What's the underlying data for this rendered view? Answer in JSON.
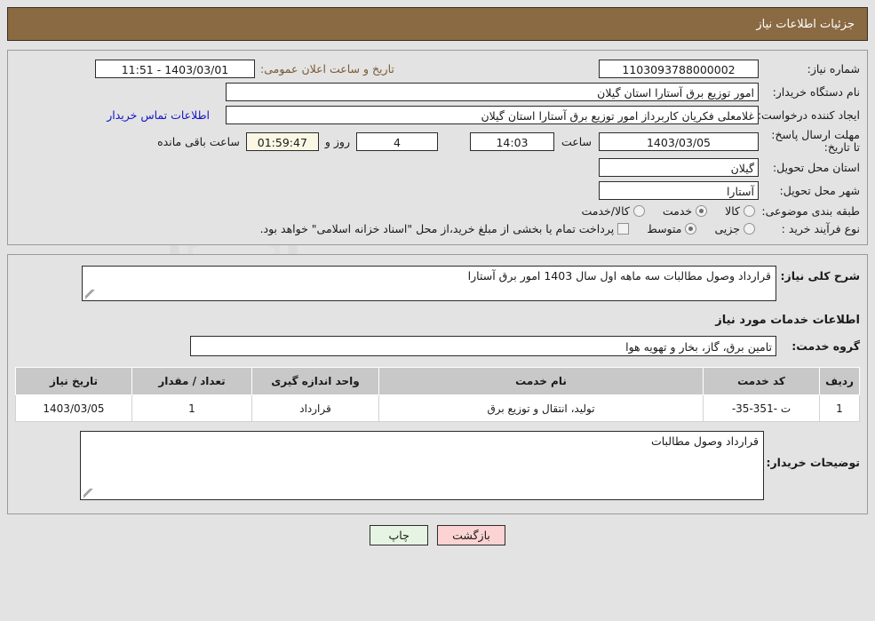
{
  "header": {
    "title": "جزئیات اطلاعات نیاز",
    "bg_color": "#8a6a42"
  },
  "watermark": {
    "text": "AnaTender.net"
  },
  "top_panel": {
    "need_number": {
      "label": "شماره نیاز:",
      "value": "1103093788000002"
    },
    "public_announce": {
      "label": "تاریخ و ساعت اعلان عمومی:",
      "value": "1403/03/01 - 11:51",
      "label_color": "#7a5a35"
    },
    "buyer_org": {
      "label": "نام دستگاه خریدار:",
      "value": "امور توزیع برق آستارا استان گیلان"
    },
    "request_creator": {
      "label": "ایجاد کننده درخواست:",
      "value": "غلامعلی فکریان کاربرداز امور توزیع برق آستارا استان گیلان"
    },
    "contact_link": {
      "label": "اطلاعات تماس خریدار",
      "color": "#1414c8"
    },
    "deadline": {
      "label": "مهلت ارسال پاسخ: تا تاریخ:",
      "date": "1403/03/05",
      "time_label": "ساعت",
      "time": "14:03",
      "days": "4",
      "days_suffix": "روز و",
      "countdown": "01:59:47",
      "countdown_suffix": "ساعت باقی مانده"
    },
    "delivery_province": {
      "label": "استان محل تحویل:",
      "value": "گیلان"
    },
    "delivery_city": {
      "label": "شهر محل تحویل:",
      "value": "آستارا"
    },
    "category": {
      "label": "طبقه بندی موضوعی:",
      "options": [
        {
          "label": "کالا",
          "selected": false
        },
        {
          "label": "خدمت",
          "selected": true
        },
        {
          "label": "کالا/خدمت",
          "selected": false
        }
      ]
    },
    "purchase_type": {
      "label": "نوع فرآیند خرید :",
      "options": [
        {
          "label": "جزیی",
          "selected": false
        },
        {
          "label": "متوسط",
          "selected": true
        }
      ],
      "checkbox_checked": false,
      "note": "پرداخت تمام یا بخشی از مبلغ خرید،از محل \"اسناد خزانه اسلامی\" خواهد بود."
    }
  },
  "mid_panel": {
    "summary": {
      "label": "شرح کلی نیاز:",
      "value": "قرارداد وصول مطالبات سه ماهه اول سال 1403 امور برق  آستارا"
    },
    "services_title": "اطلاعات خدمات مورد نیاز",
    "service_group": {
      "label": "گروه خدمت:",
      "value": "تامین برق، گاز، بخار و تهویه هوا"
    },
    "table": {
      "columns": [
        "ردیف",
        "کد خدمت",
        "نام خدمت",
        "واحد اندازه گیری",
        "تعداد / مقدار",
        "تاریخ نیاز"
      ],
      "rows": [
        {
          "row_no": "1",
          "service_code": "ت -351-35-",
          "service_name": "تولید، انتقال و توزیع برق",
          "unit": "قرارداد",
          "quantity": "1",
          "need_date": "1403/03/05"
        }
      ]
    },
    "buyer_notes": {
      "label": "توضیحات خریدار:",
      "value": "قرارداد وصول مطالبات"
    }
  },
  "footer": {
    "print_button": "چاپ",
    "back_button": "بازگشت"
  }
}
